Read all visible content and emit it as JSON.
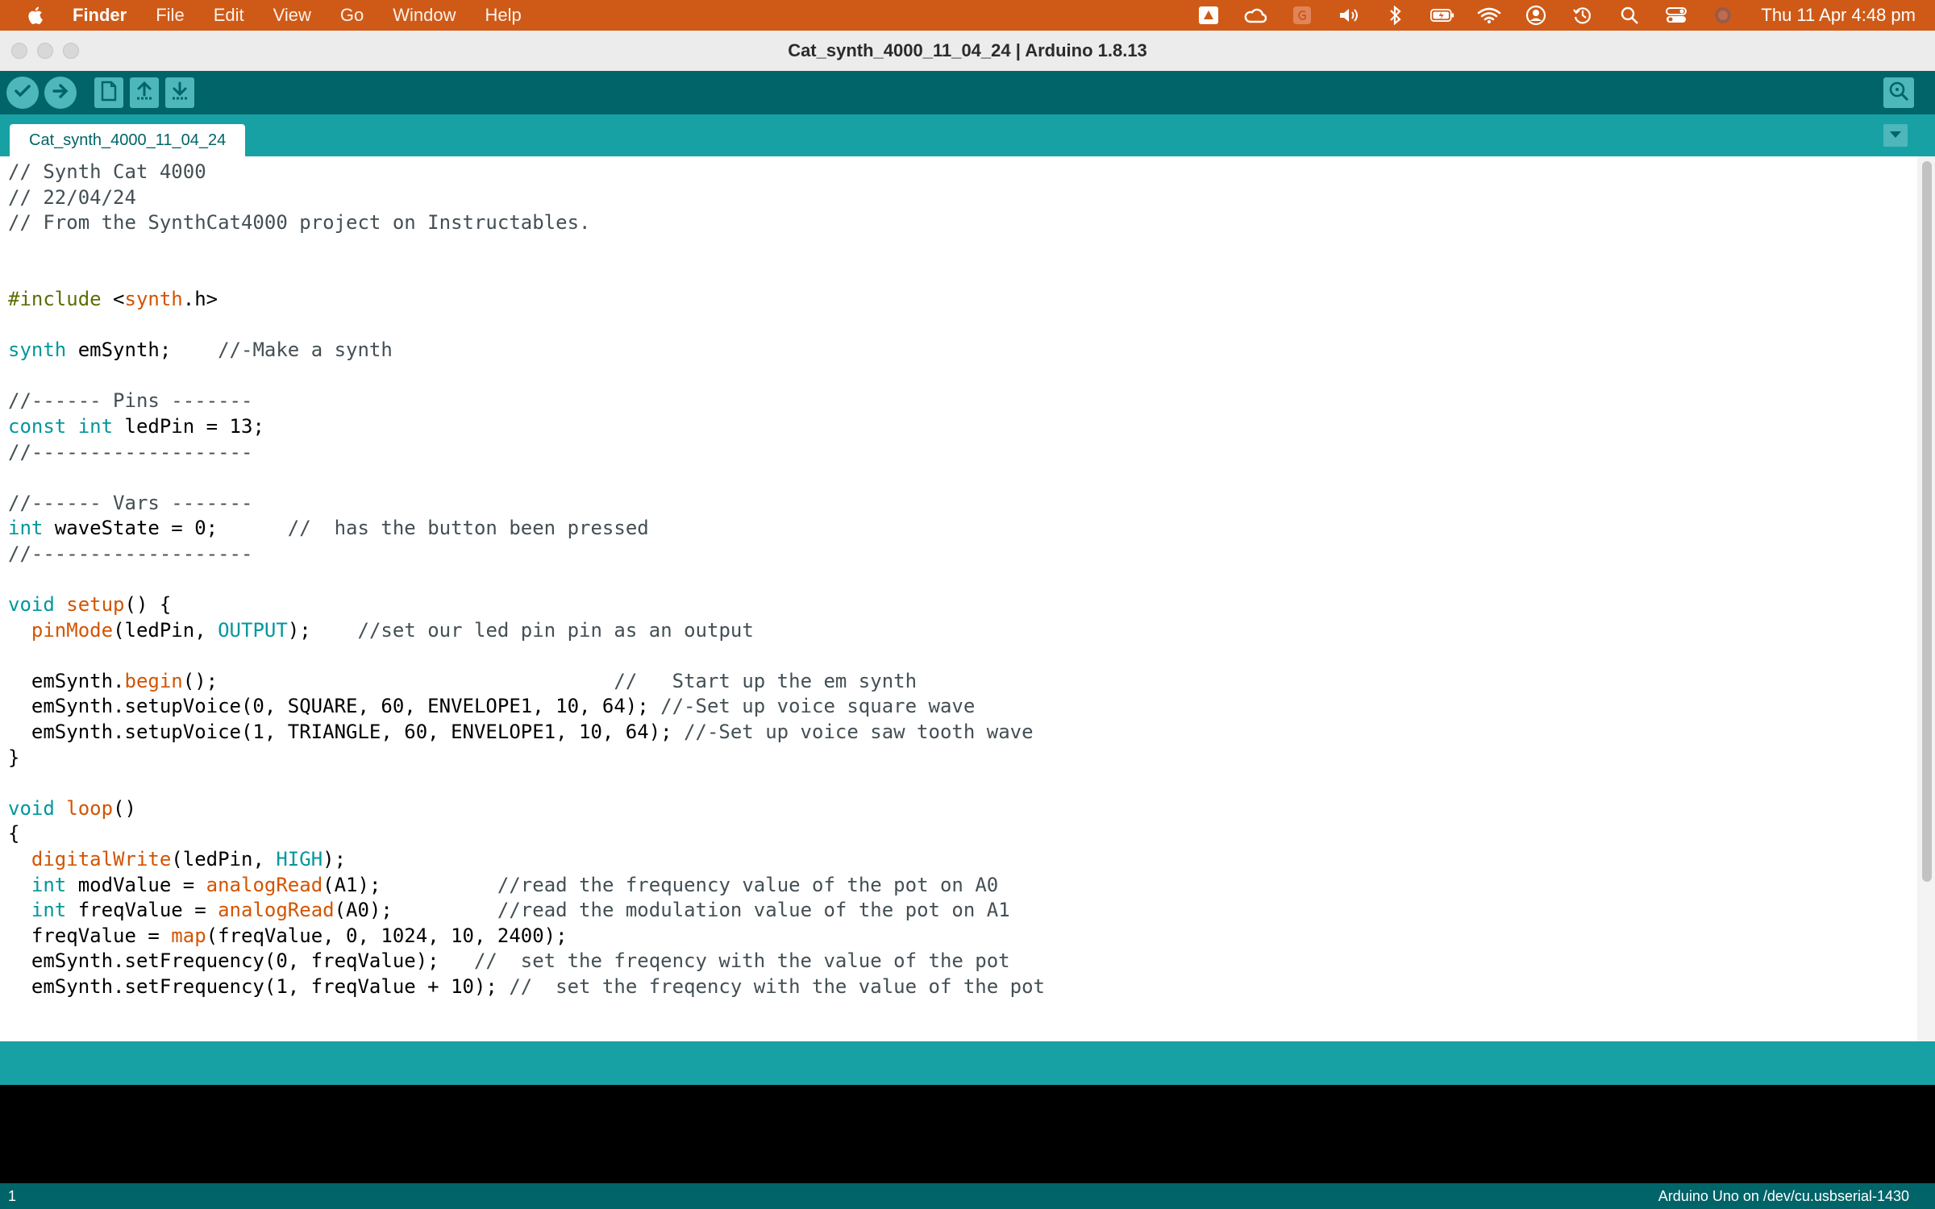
{
  "menubar": {
    "app_name": "Finder",
    "items": [
      "File",
      "Edit",
      "View",
      "Go",
      "Window",
      "Help"
    ],
    "clock": "Thu 11 Apr  4:48 pm",
    "status_icons": [
      "drive-icon",
      "creative-cloud-icon",
      "grammarly-icon",
      "volume-icon",
      "bluetooth-icon",
      "battery-icon",
      "wifi-icon",
      "user-icon",
      "time-machine-icon",
      "spotlight-icon",
      "control-center-icon",
      "siri-icon"
    ]
  },
  "window": {
    "title": "Cat_synth_4000_11_04_24 | Arduino 1.8.13"
  },
  "toolbar": {
    "buttons": [
      "verify-icon",
      "upload-icon",
      "new-icon",
      "open-icon",
      "save-icon"
    ],
    "serial_monitor": "serial-monitor-icon"
  },
  "tabs": [
    {
      "label": "Cat_synth_4000_11_04_24",
      "active": true
    }
  ],
  "editor": {
    "lines": [
      "// Synth Cat 4000",
      "// 22/04/24",
      "// From the SynthCat4000 project on Instructables.",
      "",
      "",
      "#include <synth.h>",
      "",
      "synth emSynth;    //-Make a synth",
      "",
      "//------ Pins -------",
      "const int ledPin = 13;",
      "//-------------------",
      "",
      "//------ Vars -------",
      "int waveState = 0;      //  has the button been pressed",
      "//-------------------",
      "",
      "void setup() {",
      "  pinMode(ledPin, OUTPUT);    //set our led pin pin as an output",
      "",
      "  emSynth.begin();                                  //   Start up the em synth",
      "  emSynth.setupVoice(0, SQUARE, 60, ENVELOPE1, 10, 64); //-Set up voice square wave",
      "  emSynth.setupVoice(1, TRIANGLE, 60, ENVELOPE1, 10, 64); //-Set up voice saw tooth wave",
      "}",
      "",
      "void loop()",
      "{",
      "  digitalWrite(ledPin, HIGH);",
      "  int modValue = analogRead(A1);          //read the frequency value of the pot on A0",
      "  int freqValue = analogRead(A0);         //read the modulation value of the pot on A1",
      "  freqValue = map(freqValue, 0, 1024, 10, 2400);",
      "  emSynth.setFrequency(0, freqValue);   //  set the freqency with the value of the pot",
      "  emSynth.setFrequency(1, freqValue + 10); //  set the freqency with the value of the pot"
    ]
  },
  "statusbar": {
    "line_number": "1",
    "board": "Arduino Uno on /dev/cu.usbserial-1430"
  },
  "colors": {
    "menubar": "#cf5a17",
    "toolbar": "#006468",
    "tabstrip": "#17a1a5",
    "button": "#4db7bb",
    "keyword_type": "#00979c",
    "keyword_function": "#d35400",
    "preprocessor": "#5e6d03",
    "comment": "#434f54"
  }
}
